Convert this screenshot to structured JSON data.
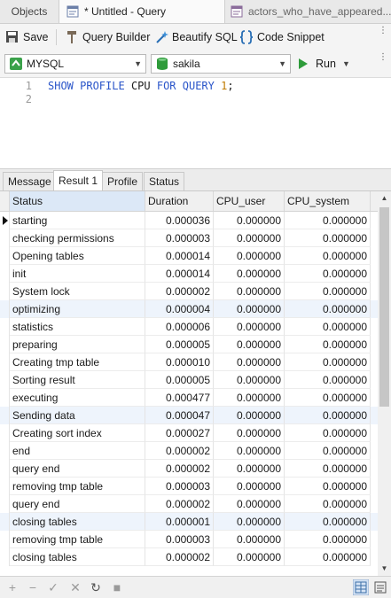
{
  "tabs": {
    "objects": "Objects",
    "query": "* Untitled - Query",
    "other": "actors_who_have_appeared..."
  },
  "toolbar": {
    "save": "Save",
    "query_builder": "Query Builder",
    "beautify": "Beautify SQL",
    "snippet": "Code Snippet"
  },
  "connection": {
    "server": "MYSQL",
    "database": "sakila",
    "run": "Run"
  },
  "editor": {
    "line_numbers": [
      "1",
      "2"
    ],
    "kw1": "SHOW PROFILE",
    "plain1": "CPU",
    "kw2": "FOR QUERY",
    "num": "1",
    "end": ";"
  },
  "result_tabs": [
    "Message",
    "Result 1",
    "Profile",
    "Status"
  ],
  "columns": [
    "Status",
    "Duration",
    "CPU_user",
    "CPU_system"
  ],
  "rows": [
    [
      "starting",
      "0.000036",
      "0.000000",
      "0.000000"
    ],
    [
      "checking permissions",
      "0.000003",
      "0.000000",
      "0.000000"
    ],
    [
      "Opening tables",
      "0.000014",
      "0.000000",
      "0.000000"
    ],
    [
      "init",
      "0.000014",
      "0.000000",
      "0.000000"
    ],
    [
      "System lock",
      "0.000002",
      "0.000000",
      "0.000000"
    ],
    [
      "optimizing",
      "0.000004",
      "0.000000",
      "0.000000"
    ],
    [
      "statistics",
      "0.000006",
      "0.000000",
      "0.000000"
    ],
    [
      "preparing",
      "0.000005",
      "0.000000",
      "0.000000"
    ],
    [
      "Creating tmp table",
      "0.000010",
      "0.000000",
      "0.000000"
    ],
    [
      "Sorting result",
      "0.000005",
      "0.000000",
      "0.000000"
    ],
    [
      "executing",
      "0.000477",
      "0.000000",
      "0.000000"
    ],
    [
      "Sending data",
      "0.000047",
      "0.000000",
      "0.000000"
    ],
    [
      "Creating sort index",
      "0.000027",
      "0.000000",
      "0.000000"
    ],
    [
      "end",
      "0.000002",
      "0.000000",
      "0.000000"
    ],
    [
      "query end",
      "0.000002",
      "0.000000",
      "0.000000"
    ],
    [
      "removing tmp table",
      "0.000003",
      "0.000000",
      "0.000000"
    ],
    [
      "query end",
      "0.000002",
      "0.000000",
      "0.000000"
    ],
    [
      "closing tables",
      "0.000001",
      "0.000000",
      "0.000000"
    ],
    [
      "removing tmp table",
      "0.000003",
      "0.000000",
      "0.000000"
    ],
    [
      "closing tables",
      "0.000002",
      "0.000000",
      "0.000000"
    ]
  ],
  "colors": {
    "row_highlight": "#eef4fc",
    "header_selected": "#dce8f7",
    "keyword": "#2a55c9",
    "number": "#c07a00",
    "run_green": "#2e9b3a",
    "db_green": "#2e9b3a"
  }
}
